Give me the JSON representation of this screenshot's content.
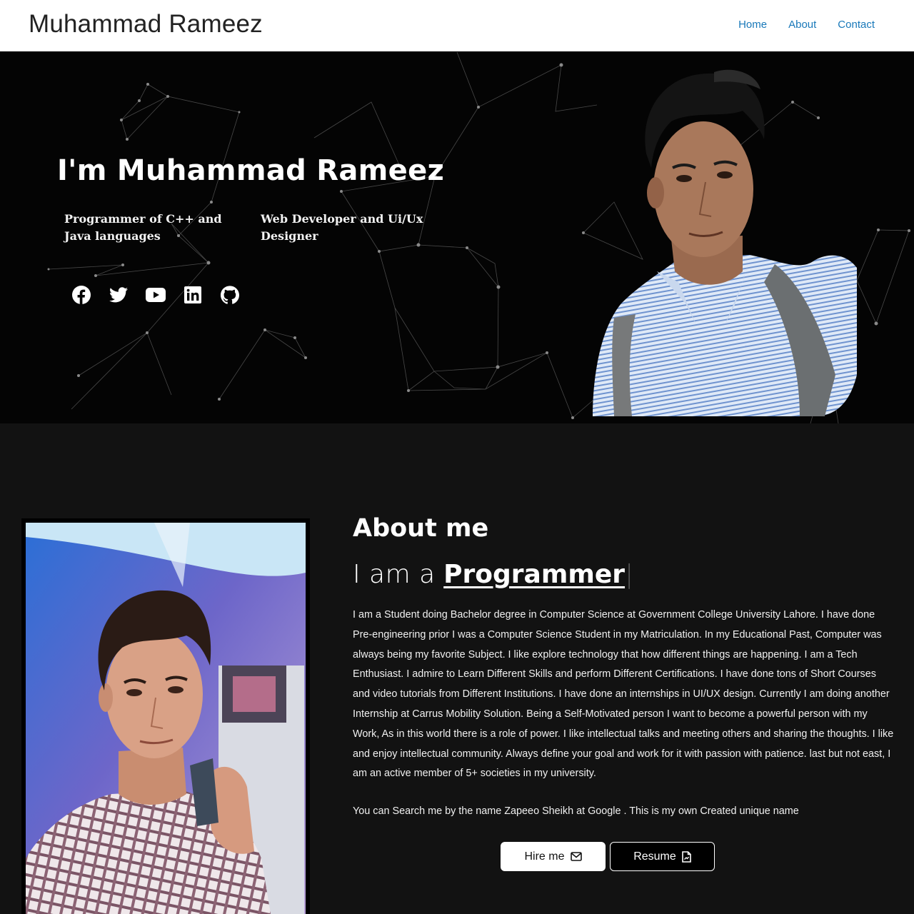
{
  "header": {
    "site_title": "Muhammad Rameez",
    "nav": [
      {
        "label": "Home"
      },
      {
        "label": "About"
      },
      {
        "label": "Contact"
      }
    ]
  },
  "hero": {
    "title": "I'm Muhammad Rameez",
    "subtitle_left": "Programmer of C++ and Java languages",
    "subtitle_right": "Web Developer and Ui/Ux Designer",
    "socials": [
      {
        "icon": "facebook-icon"
      },
      {
        "icon": "twitter-icon"
      },
      {
        "icon": "youtube-icon"
      },
      {
        "icon": "linkedin-icon"
      },
      {
        "icon": "github-icon"
      }
    ]
  },
  "about": {
    "heading": "About me",
    "typed_prefix": "I am a",
    "typed_word": "Programmer",
    "cursor": "|",
    "paragraph": "I am a Student doing Bachelor degree in Computer Science at  Government College University Lahore. I have done Pre-engineering prior I was a Computer Science Student in my Matriculation. In my Educational Past, Computer was always being my favorite Subject. I like explore technology that how different things are happening.  I am a Tech Enthusiast. I admire to Learn Different Skills and perform Different Certifications. I have done tons of Short Courses and video tutorials from Different Institutions. I have done an internships in UI/UX design. Currently I am doing another Internship at Carrus Mobility Solution. Being a Self-Motivated person I want to become a powerful person with my Work, As in this world there is a role of power. I like intellectual talks and meeting others and sharing the thoughts. I like and enjoy  intellectual community. Always define your goal and work for it with passion with patience. last but not east, I am an active member of 5+ societies in my university.",
    "note": "You can Search me by the name Zapeeo Sheikh at Google . This is my own Created unique name",
    "hire_label": "Hire me",
    "resume_label": "Resume"
  },
  "colors": {
    "nav_link": "#1878b9",
    "hero_bg": "#040404",
    "page_bg": "#121212"
  }
}
